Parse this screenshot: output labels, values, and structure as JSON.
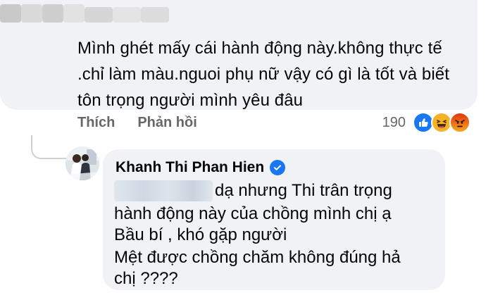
{
  "parent_comment": {
    "text": "Mình ghét mấy cái hành động này.không thực tế .chỉ làm màu.nguoi phụ nữ vậy có gì là tốt và biết tôn trọng người mình yêu đâu",
    "actions": {
      "like_label": "Thích",
      "reply_label": "Phản hồi"
    },
    "reactions": {
      "count": "190",
      "icons": [
        "like-reaction",
        "haha-reaction",
        "angry-reaction"
      ],
      "colors": {
        "like": "#1877f2",
        "haha": "#f7b125",
        "angry": "#e9710f"
      }
    }
  },
  "reply": {
    "author": "Khanh Thi Phan Hien",
    "verified": true,
    "lines": [
      "dạ nhưng Thi trân trọng",
      "hành động này của chồng mình chị ạ",
      "Bầu bí , khó gặp người",
      "Mệt được chồng chăm không đúng hả",
      "chị ????"
    ]
  },
  "colors": {
    "bubble_bg": "#f0f2f5",
    "text": "#050505",
    "secondary": "#65676b",
    "verified": "#1877f2"
  }
}
